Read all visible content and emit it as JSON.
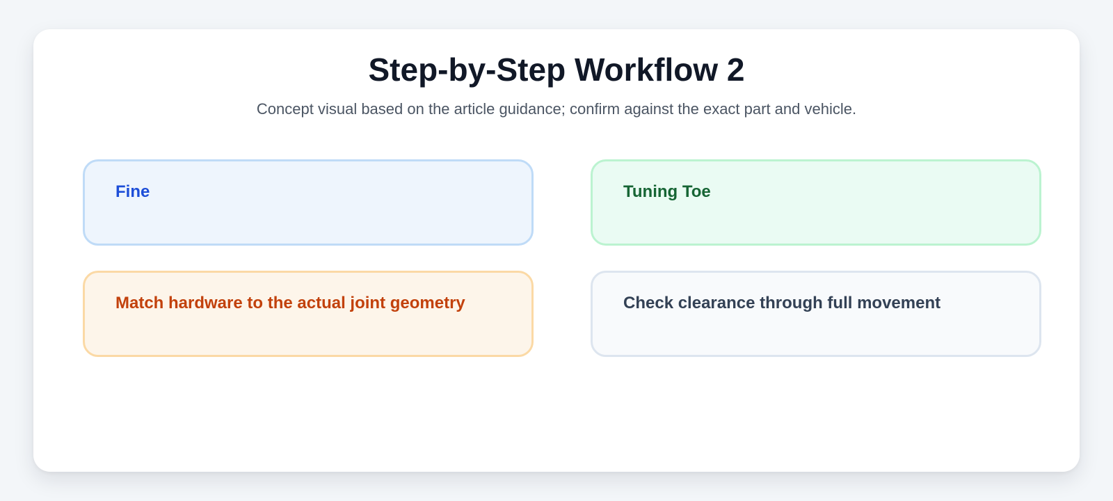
{
  "title": "Step-by-Step Workflow 2",
  "subtitle": "Concept visual based on the article guidance; confirm against the exact part and vehicle.",
  "steps": [
    {
      "label": "Fine",
      "accent": "#1d4ed8",
      "background": "#eef5fd",
      "border": "#bfdbf7"
    },
    {
      "label": "Tuning Toe",
      "accent": "#166534",
      "background": "#eafbf3",
      "border": "#bbf3d0"
    },
    {
      "label": "Match hardware to the actual joint geometry",
      "accent": "#c2410c",
      "background": "#fdf5ea",
      "border": "#fbd9a5"
    },
    {
      "label": "Check clearance through full movement",
      "accent": "#334155",
      "background": "#f8fafc",
      "border": "#dde5ef"
    }
  ]
}
